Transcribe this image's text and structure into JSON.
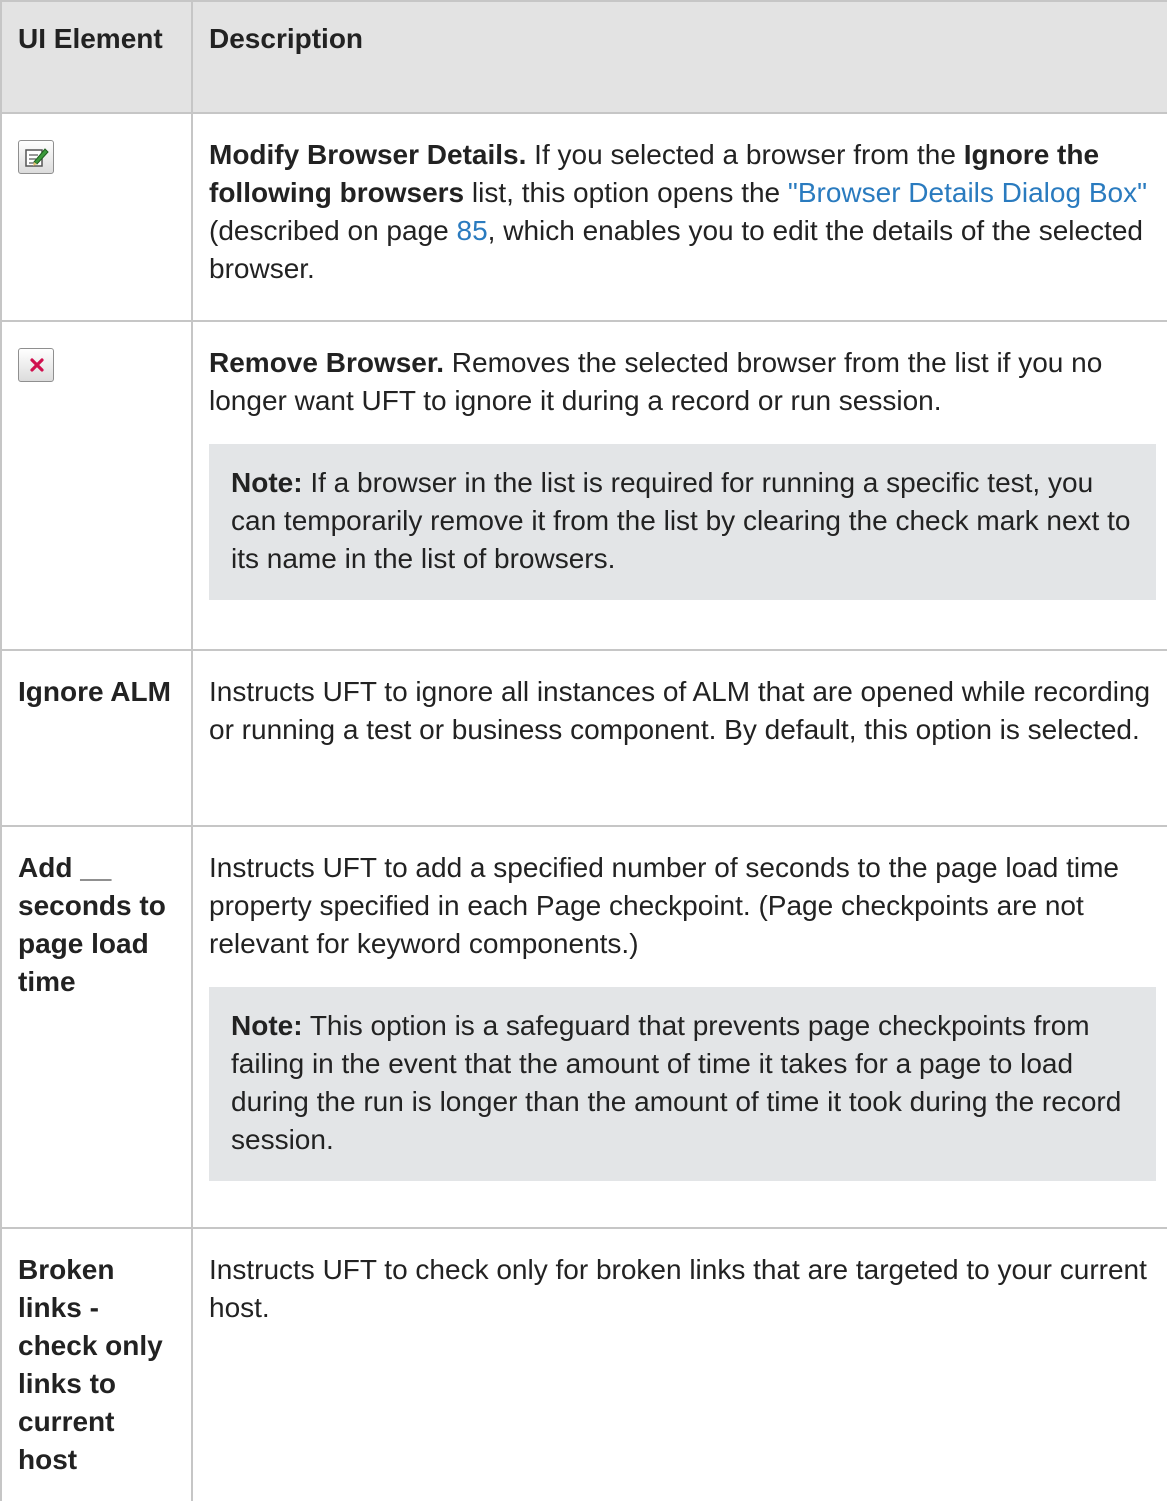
{
  "table": {
    "headers": [
      "UI Element",
      "Description"
    ],
    "rows": [
      {
        "element_icon": "modify-browser-icon",
        "title": "Modify Browser Details.",
        "text1": " If you selected a browser from the ",
        "bold1": "Ignore the following browsers",
        "text2": " list, this option opens the ",
        "link1": "\"Browser Details Dialog Box\"",
        "text3": " (described on page ",
        "link2": "85",
        "text4": ", which enables you to edit the details of the selected browser."
      },
      {
        "element_icon": "remove-browser-icon",
        "title": "Remove Browser.",
        "text1": " Removes the selected browser from the list if you no longer want UFT to ignore it during a record or run session.",
        "note_label": "Note:",
        "note_text": " If a browser in the list is required for running a specific test, you can temporarily remove it from the list by clearing the check mark next to its name in the list of browsers."
      },
      {
        "element": "Ignore ALM",
        "description": "Instructs UFT to ignore all instances of ALM that are opened while recording or running a test or business component. By default, this option is selected."
      },
      {
        "element": "Add __ seconds to page load time",
        "description": "Instructs UFT to add a specified number of seconds to the page load time property specified in each Page checkpoint. (Page checkpoints are not relevant for keyword components.)",
        "note_label": "Note:",
        "note_text": " This option is a safeguard that prevents page checkpoints from failing in the event that the amount of time it takes for a page to load during the run is longer than the amount of time it took during the record session."
      },
      {
        "element": "Broken links - check only links to current host",
        "description": "Instructs UFT to check only for broken links that are targeted to your current host."
      }
    ]
  },
  "colors": {
    "header_bg": "#e3e3e3",
    "note_bg": "#e3e5e7",
    "link": "#2a7bbf",
    "border": "#c6c6c6"
  }
}
